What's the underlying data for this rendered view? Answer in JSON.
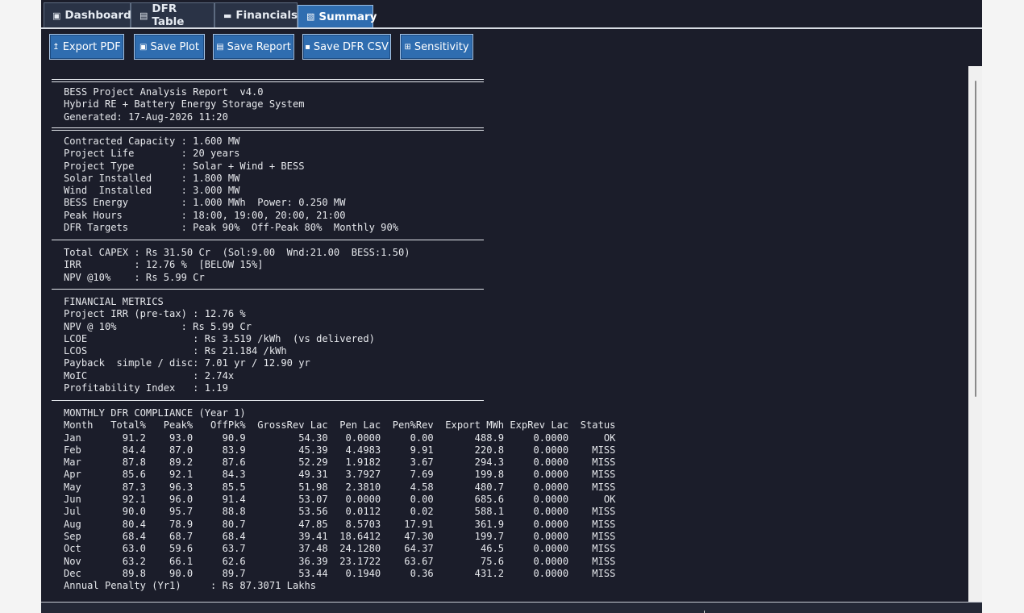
{
  "tabs": [
    {
      "label": "Dashboard",
      "icon": "dashboard-icon",
      "glyph": "▣"
    },
    {
      "label": "DFR Table",
      "icon": "table-icon",
      "glyph": "▤"
    },
    {
      "label": "Financials",
      "icon": "wallet-icon",
      "glyph": "▬"
    },
    {
      "label": "Summary",
      "icon": "document-icon",
      "glyph": "▧",
      "active": true
    }
  ],
  "toolbar": {
    "buttons": [
      {
        "label": "Export PDF",
        "icon": "export-icon",
        "glyph": "↥"
      },
      {
        "label": "Save Plot",
        "icon": "save-plot-icon",
        "glyph": "▣"
      },
      {
        "label": "Save Report",
        "icon": "report-icon",
        "glyph": "▤"
      },
      {
        "label": "Save DFR CSV",
        "icon": "save-icon",
        "glyph": "▪"
      },
      {
        "label": "Sensitivity",
        "icon": "grid-icon",
        "glyph": "⊞"
      }
    ]
  },
  "colors": {
    "background": "#1b1d2a",
    "accent": "#2f6db0",
    "text": "#e6e8ec"
  },
  "report": {
    "header": [
      "BESS Project Analysis Report  v4.0",
      "Hybrid RE + Battery Energy Storage System",
      "Generated: 17-Aug-2026 11:20"
    ],
    "project": [
      "Contracted Capacity : 1.600 MW",
      "Project Life        : 20 years",
      "Project Type        : Solar + Wind + BESS",
      "Solar Installed     : 1.800 MW",
      "Wind  Installed     : 3.000 MW",
      "BESS Energy         : 1.000 MWh  Power: 0.250 MW",
      "Peak Hours          : 18:00, 19:00, 20:00, 21:00",
      "DFR Targets         : Peak 90%  Off-Peak 80%  Monthly 90%"
    ],
    "summary": [
      "Total CAPEX : Rs 31.50 Cr  (Sol:9.00  Wnd:21.00  BESS:1.50)",
      "IRR         : 12.76 %  [BELOW 15%]",
      "NPV @10%    : Rs 5.99 Cr"
    ],
    "financial": [
      "FINANCIAL METRICS",
      "Project IRR (pre-tax) : 12.76 %",
      "NPV @ 10%           : Rs 5.99 Cr",
      "LCOE                  : Rs 3.519 /kWh  (vs delivered)",
      "LCOS                  : Rs 21.184 /kWh",
      "Payback  simple / disc: 7.01 yr / 12.90 yr",
      "MoIC                  : 2.74x",
      "Profitability Index   : 1.19"
    ],
    "compliance": {
      "title": "MONTHLY DFR COMPLIANCE (Year 1)",
      "columns": [
        "Month",
        "Total%",
        "Peak%",
        "OffPk%",
        "GrossRev Lac",
        "Pen Lac",
        "Pen%Rev",
        "Export MWh",
        "ExpRev Lac",
        "Status"
      ],
      "rows": [
        [
          "Jan",
          "91.2",
          "93.0",
          "90.9",
          "54.30",
          "0.0000",
          "0.00",
          "488.9",
          "0.0000",
          "OK"
        ],
        [
          "Feb",
          "84.4",
          "87.0",
          "83.9",
          "45.39",
          "4.4983",
          "9.91",
          "220.8",
          "0.0000",
          "MISS"
        ],
        [
          "Mar",
          "87.8",
          "89.2",
          "87.6",
          "52.29",
          "1.9182",
          "3.67",
          "294.3",
          "0.0000",
          "MISS"
        ],
        [
          "Apr",
          "85.6",
          "92.1",
          "84.3",
          "49.31",
          "3.7927",
          "7.69",
          "199.8",
          "0.0000",
          "MISS"
        ],
        [
          "May",
          "87.3",
          "96.3",
          "85.5",
          "51.98",
          "2.3810",
          "4.58",
          "480.7",
          "0.0000",
          "MISS"
        ],
        [
          "Jun",
          "92.1",
          "96.0",
          "91.4",
          "53.07",
          "0.0000",
          "0.00",
          "685.6",
          "0.0000",
          "OK"
        ],
        [
          "Jul",
          "90.0",
          "95.7",
          "88.8",
          "53.56",
          "0.0112",
          "0.02",
          "588.1",
          "0.0000",
          "MISS"
        ],
        [
          "Aug",
          "80.4",
          "78.9",
          "80.7",
          "47.85",
          "8.5703",
          "17.91",
          "361.9",
          "0.0000",
          "MISS"
        ],
        [
          "Sep",
          "68.4",
          "68.7",
          "68.4",
          "39.41",
          "18.6412",
          "47.30",
          "199.7",
          "0.0000",
          "MISS"
        ],
        [
          "Oct",
          "63.0",
          "59.6",
          "63.7",
          "37.48",
          "24.1280",
          "64.37",
          "46.5",
          "0.0000",
          "MISS"
        ],
        [
          "Nov",
          "63.2",
          "66.1",
          "62.6",
          "36.39",
          "23.1722",
          "63.67",
          "75.6",
          "0.0000",
          "MISS"
        ],
        [
          "Dec",
          "89.8",
          "90.0",
          "89.7",
          "53.44",
          "0.1940",
          "0.36",
          "431.2",
          "0.0000",
          "MISS"
        ]
      ],
      "annual_penalty": "Annual Penalty (Yr1)     : Rs 87.3071 Lakhs"
    }
  }
}
